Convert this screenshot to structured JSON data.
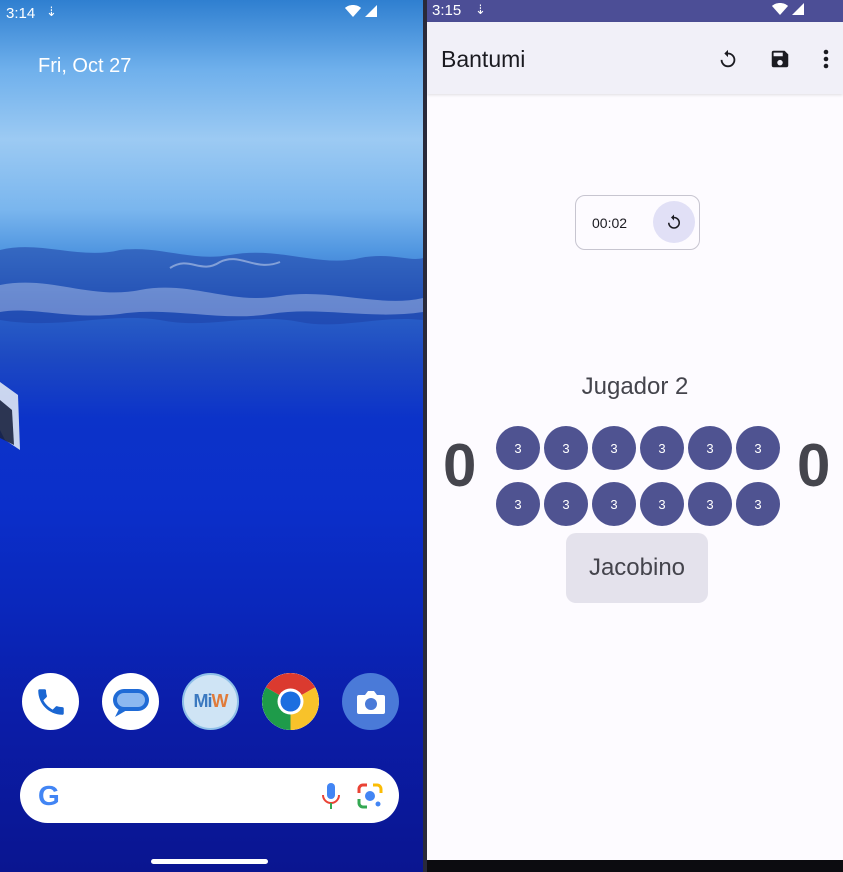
{
  "left_screen": {
    "status_bar": {
      "time": "3:14"
    },
    "date": "Fri, Oct 27",
    "dock": [
      {
        "name": "phone"
      },
      {
        "name": "messages"
      },
      {
        "name": "miw",
        "label": "MiW"
      },
      {
        "name": "chrome"
      },
      {
        "name": "camera"
      }
    ],
    "search": {
      "logo": "G"
    }
  },
  "right_screen": {
    "status_bar": {
      "time": "3:15"
    },
    "app_bar": {
      "title": "Bantumi",
      "actions": [
        "restart-icon",
        "save-icon",
        "more-vert-icon"
      ]
    },
    "timer": {
      "value": "00:02"
    },
    "game": {
      "player2_name": "Jugador 2",
      "player1_name": "Jacobino",
      "player2_store": "0",
      "player1_store": "0",
      "top_row": [
        "3",
        "3",
        "3",
        "3",
        "3",
        "3"
      ],
      "bottom_row": [
        "3",
        "3",
        "3",
        "3",
        "3",
        "3"
      ]
    },
    "colors": {
      "accent": "#4f5391",
      "status_bar": "#4c4e96",
      "app_bar": "#f1f0f8"
    }
  }
}
